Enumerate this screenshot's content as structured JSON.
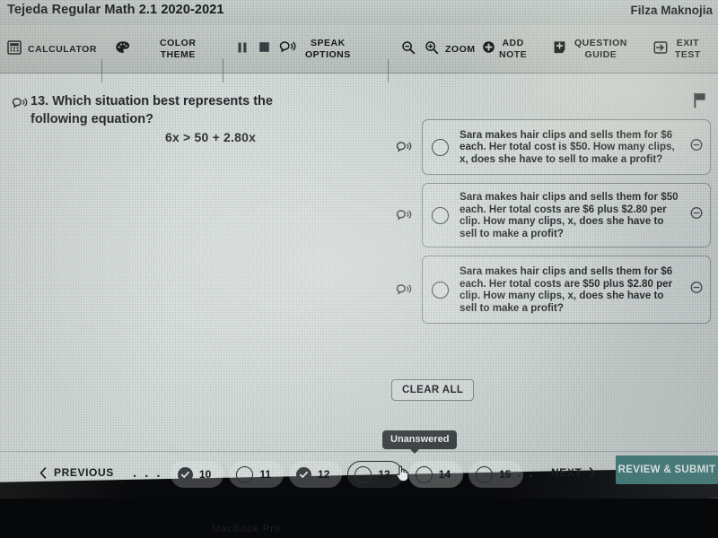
{
  "titlebar": {
    "course": "Tejeda Regular Math 2.1 2020-2021",
    "student": "Filza Maknojia"
  },
  "toolbar": {
    "calculator": "CALCULATOR",
    "color_theme": "COLOR\nTHEME",
    "speak_options": "SPEAK\nOPTIONS",
    "zoom": "ZOOM",
    "add_note": "ADD\nNOTE",
    "question_guide": "QUESTION\nGUIDE",
    "exit_test": "EXIT\nTEST",
    "icons": {
      "calculator": "calculator-icon",
      "palette": "palette-icon",
      "pause": "pause-icon",
      "stop": "stop-icon",
      "speak": "speak-icon",
      "zoom_out": "zoom-out-icon",
      "zoom_in": "zoom-in-icon",
      "zoom_plus": "plus-circle-icon",
      "note": "note-plus-icon",
      "guide": "arrow-into-box-icon",
      "exit": "exit-icon"
    }
  },
  "question": {
    "number": "13.",
    "prompt": "Which situation best represents the following equation?",
    "equation": "6x > 50 + 2.80x",
    "speak_icon": "speak-icon",
    "flag_icon": "flag-icon"
  },
  "choices": [
    {
      "text": "Sara makes hair clips and sells them for $6 each. Her total cost is $50. How many clips, x, does she have to sell to make a profit?",
      "selected": false
    },
    {
      "text": "Sara makes hair clips and sells them for $50 each. Her total costs are $6 plus $2.80 per clip. How many clips, x, does she have to sell to make a profit?",
      "selected": false
    },
    {
      "text": "Sara makes hair clips and sells them for $6 each. Her total costs are $50 plus $2.80 per clip. How many clips, x, does she have to sell to make a profit?",
      "selected": false
    }
  ],
  "clear_all": "CLEAR ALL",
  "tooltip": "Unanswered",
  "nav": {
    "previous": "PREVIOUS",
    "next": "NEXT",
    "ellipsis_left": "· · ·",
    "ellipsis_right": "· · ·",
    "submit": "REVIEW & SUBMIT",
    "questions": [
      {
        "number": "10",
        "state": "answered"
      },
      {
        "number": "11",
        "state": "unanswered"
      },
      {
        "number": "12",
        "state": "answered"
      },
      {
        "number": "13",
        "state": "current"
      },
      {
        "number": "14",
        "state": "hovered"
      },
      {
        "number": "15",
        "state": "unanswered"
      }
    ]
  },
  "bezel": {
    "label": "MacBook Pro"
  },
  "colors": {
    "submit_button": "#3f7a77",
    "toolbar": "#c6c9c5",
    "text": "#16191c",
    "tooltip_bg": "#3b3f42"
  }
}
